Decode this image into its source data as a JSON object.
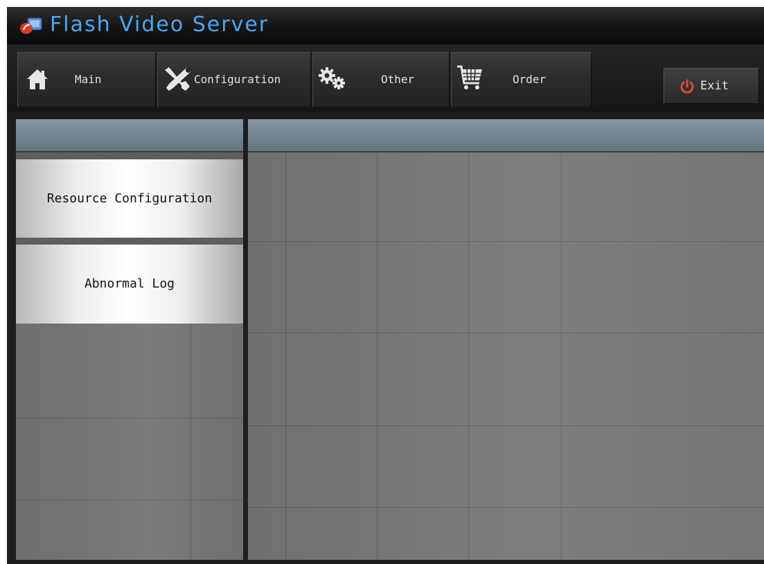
{
  "app": {
    "title": "Flash Video Server",
    "logo_icon": "flash-logo-icon"
  },
  "nav": {
    "items": [
      {
        "label": "Main",
        "icon": "home-icon"
      },
      {
        "label": "Configuration",
        "icon": "tools-icon"
      },
      {
        "label": "Other",
        "icon": "gears-icon"
      },
      {
        "label": "Order",
        "icon": "cart-icon"
      }
    ],
    "exit": {
      "label": "Exit",
      "icon": "power-icon"
    }
  },
  "sidebar": {
    "items": [
      {
        "label": "Resource Configuration"
      },
      {
        "label": "Abnormal Log"
      }
    ]
  },
  "colors": {
    "title": "#4aa6ee",
    "exit_icon": "#e04a3a",
    "header_bar": "#7a8c98"
  }
}
